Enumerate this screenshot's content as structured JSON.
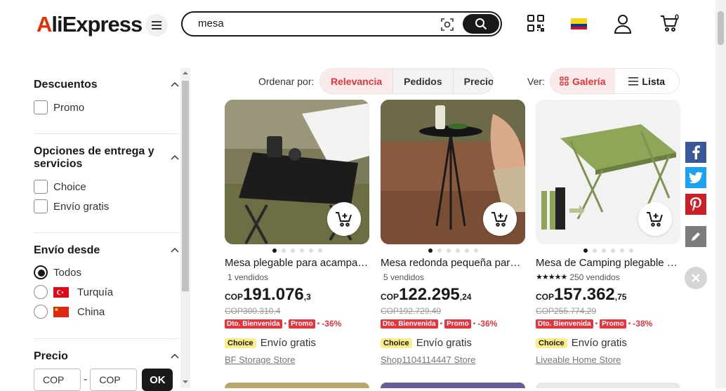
{
  "header": {
    "logo_a": "A",
    "logo_rest": "liExpress",
    "search_value": "mesa",
    "cart_count": "0"
  },
  "sidebar": {
    "descuentos": {
      "title": "Descuentos",
      "options": [
        "Promo"
      ]
    },
    "entrega": {
      "title": "Opciones de entrega y servicios",
      "options": [
        "Choice",
        "Envío gratis"
      ]
    },
    "envio_desde": {
      "title": "Envío desde",
      "options": [
        "Todos",
        "Turquía",
        "China"
      ],
      "selected": "Todos"
    },
    "precio": {
      "title": "Precio",
      "min_placeholder": "COP",
      "max_placeholder": "COP",
      "separator": "-",
      "ok_label": "OK"
    }
  },
  "sort": {
    "label": "Ordenar por:",
    "options": [
      "Relevancia",
      "Pedidos",
      "Precio"
    ],
    "active": "Relevancia"
  },
  "view": {
    "label": "Ver:",
    "options": [
      "Galería",
      "Lista"
    ],
    "active": "Galería"
  },
  "products": [
    {
      "title": "Mesa plegable para acampar al aire libre",
      "sold": "1 vendidos",
      "rating_stars": false,
      "price_cur": "COP",
      "price_int": "191.076",
      "price_dec": ",3",
      "old_price": "COP300.310,4",
      "badge1": "Dto. Bienvenida",
      "badge2": "Promo",
      "discount": "-36%",
      "choice": "Choice",
      "shipping": "Envío gratis",
      "store": "BF Storage Store"
    },
    {
      "title": "Mesa redonda pequeña para exteriores",
      "sold": "5 vendidos",
      "rating_stars": false,
      "price_cur": "COP",
      "price_int": "122.295",
      "price_dec": ",24",
      "old_price": "COP192.729,49",
      "badge1": "Dto. Bienvenida",
      "badge2": "Promo",
      "discount": "-36%",
      "choice": "Choice",
      "shipping": "Envío gratis",
      "store": "Shop1104114447 Store"
    },
    {
      "title": "Mesa de Camping plegable portátil",
      "sold": "250 vendidos",
      "rating_stars": true,
      "price_cur": "COP",
      "price_int": "157.362",
      "price_dec": ",75",
      "old_price": "COP255.774,29",
      "badge1": "Dto. Bienvenida",
      "badge2": "Promo",
      "discount": "-38%",
      "choice": "Choice",
      "shipping": "Envío gratis",
      "store": "Liveable Home Store"
    }
  ],
  "colors": {
    "accent": "#e5343c",
    "choice": "#fcee87",
    "facebook": "#3b5998",
    "twitter": "#1da1f2",
    "pinterest": "#cb2027"
  }
}
